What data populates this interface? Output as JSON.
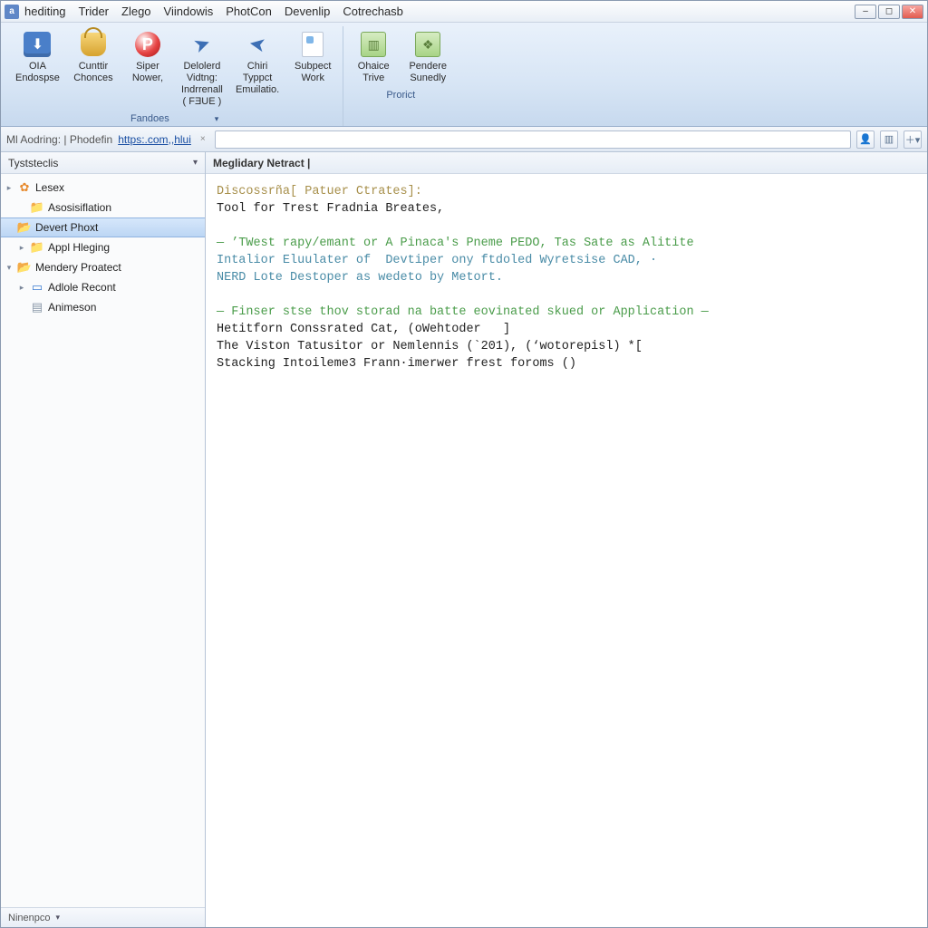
{
  "menu": [
    "hediting",
    "Trider",
    "Zlego",
    "Viindowis",
    "PhotCon",
    "Devenlip",
    "Cotrechasb"
  ],
  "ribbon": {
    "group1": {
      "label": "Fandoes",
      "items": [
        {
          "line1": "OIA",
          "line2": "Endospse",
          "icon": "box"
        },
        {
          "line1": "Cunttir",
          "line2": "Chonces",
          "icon": "bucket"
        },
        {
          "line1": "Siper",
          "line2": "Nower,",
          "icon": "p"
        },
        {
          "line1": "Delolerd",
          "line2": "Vidtng:",
          "line3": "Indrrenall",
          "line4": "( FƎUE )",
          "icon": "arrow"
        },
        {
          "line1": "Chiri",
          "line2": "Typpct",
          "line3": "Emuilatio.",
          "icon": "arrow2"
        },
        {
          "line1": "Subpect",
          "line2": "Work",
          "icon": "page"
        }
      ]
    },
    "group2": {
      "label": "Prorict",
      "items": [
        {
          "line1": "Ohaice",
          "line2": "Trive",
          "icon": "green",
          "glyph": "▥"
        },
        {
          "line1": "Pendere",
          "line2": "Sunedly",
          "icon": "green",
          "glyph": "❖"
        }
      ]
    }
  },
  "address": {
    "prefix": "Ml Aodring: | Phodefin",
    "url": "https:.com,,hlui"
  },
  "sidebar": {
    "title": "Tyststeclis",
    "footer": "Ninenpco",
    "nodes": [
      {
        "label": "Lesex",
        "icon": "puzzle",
        "tw": "▸",
        "indent": 0
      },
      {
        "label": "Asosisiflation",
        "icon": "folder",
        "tw": "",
        "indent": 1
      },
      {
        "label": "Devert Phoxt",
        "icon": "folder-open",
        "tw": "",
        "indent": 0,
        "selected": true
      },
      {
        "label": "Appl Hleging",
        "icon": "folder",
        "tw": "▸",
        "indent": 1
      },
      {
        "label": "Mendery Proatect",
        "icon": "folder-open",
        "tw": "▾",
        "indent": 0
      },
      {
        "label": "Adlole Recont",
        "icon": "card",
        "tw": "▸",
        "indent": 1
      },
      {
        "label": "Animeson",
        "icon": "doc",
        "tw": "",
        "indent": 1
      }
    ]
  },
  "editor": {
    "tab": "Meglidary Netract |",
    "lines": [
      {
        "cls": "tok-keyword",
        "text": "Discossrña[ Patuer Ctrates]:"
      },
      {
        "cls": "",
        "text": "Tool for Trest Fradnia Breates,"
      },
      {
        "cls": "",
        "text": ""
      },
      {
        "cls": "tok-comment",
        "text": "— ’TWest rapy/emant or A Pinaca's Pneme PEDO, Tas Sate as Alitite"
      },
      {
        "cls": "tok-link",
        "text": "Intalior Eluulater of  Devtiper ony ftdoled Wyretsise CAD, ·"
      },
      {
        "cls": "tok-link",
        "text": "NERD Lote Destoper as wedeto by Metort."
      },
      {
        "cls": "",
        "text": ""
      },
      {
        "cls": "tok-comment",
        "text": "— Finser stse thov storad na batte eovinated skued or Application —"
      },
      {
        "cls": "",
        "text": "Hetitforn Conssrated Cat, (oWehtoder   ]"
      },
      {
        "cls": "",
        "text": "The Viston Tatusitor or Nemlennis (`201), (‘wotorepisl) *["
      },
      {
        "cls": "",
        "text": "Stacking Intoileme3 Frann·imerwer frest foroms ()"
      }
    ]
  }
}
